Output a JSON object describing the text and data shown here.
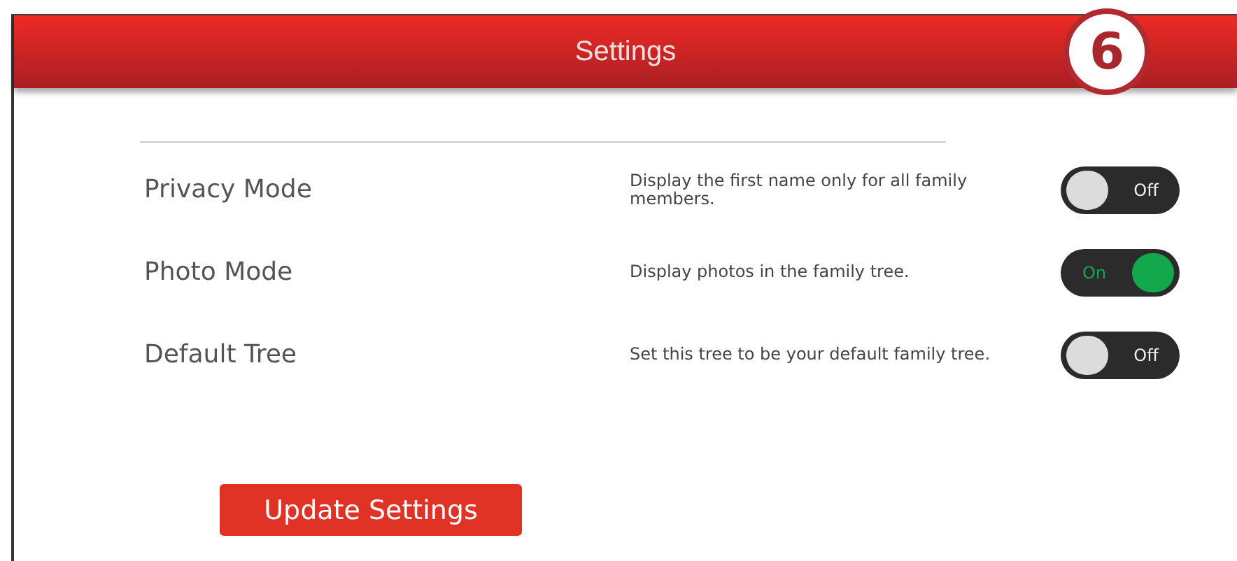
{
  "header": {
    "title": "Settings"
  },
  "step_badge": "6",
  "settings": [
    {
      "label": "Privacy Mode",
      "description": "Display the first name only for all family members.",
      "on": false,
      "toggle_text": "Off"
    },
    {
      "label": "Photo Mode",
      "description": "Display photos in the family tree.",
      "on": true,
      "toggle_text": "On"
    },
    {
      "label": "Default Tree",
      "description": "Set this tree to be your default family tree.",
      "on": false,
      "toggle_text": "Off"
    }
  ],
  "button": "Update Settings"
}
